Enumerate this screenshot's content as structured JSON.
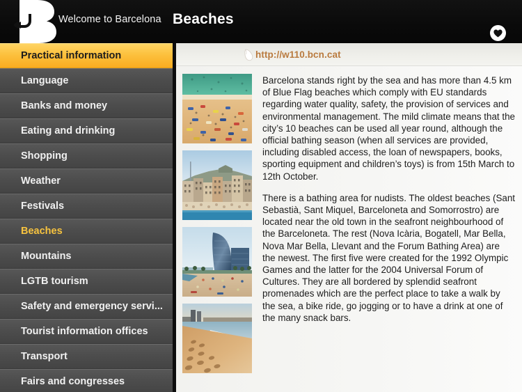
{
  "header": {
    "logo_icon": "barcelona-b-back-arrow-logo",
    "back_label": "Welcome to Barcelona",
    "title": "Beaches",
    "favorite_icon": "heart-icon"
  },
  "sidebar": {
    "items": [
      {
        "label": "Practical information",
        "state": "active"
      },
      {
        "label": "Language",
        "state": "normal"
      },
      {
        "label": "Banks and money",
        "state": "normal"
      },
      {
        "label": "Eating and drinking",
        "state": "normal"
      },
      {
        "label": "Shopping",
        "state": "normal"
      },
      {
        "label": "Weather",
        "state": "normal"
      },
      {
        "label": "Festivals",
        "state": "normal"
      },
      {
        "label": "Beaches",
        "state": "current"
      },
      {
        "label": "Mountains",
        "state": "normal"
      },
      {
        "label": "LGTB tourism",
        "state": "normal"
      },
      {
        "label": "Safety and emergency servi...",
        "state": "normal"
      },
      {
        "label": "Tourist information offices",
        "state": "normal"
      },
      {
        "label": "Transport",
        "state": "normal"
      },
      {
        "label": "Fairs and congresses",
        "state": "normal"
      }
    ]
  },
  "content": {
    "url_icon": "mouse-pointer-icon",
    "url": "http://w110.bcn.cat",
    "thumbnails": [
      {
        "name": "aerial-beach-crowd-photo",
        "alt": "Aerial view of crowded sandy beach with turquoise sea"
      },
      {
        "name": "barceloneta-seafront-buildings-photo",
        "alt": "Seafront buildings with hill and crowded beach"
      },
      {
        "name": "w-hotel-beach-photo",
        "alt": "W Barcelona hotel sail tower beside the beach"
      },
      {
        "name": "footprints-sand-beach-photo",
        "alt": "Footprints in sand at sunset with waves"
      }
    ],
    "paragraphs": [
      "Barcelona stands right by the sea and has more than 4.5 km of Blue Flag beaches which comply with EU standards regarding water quality, safety, the provision of services and environmental management. The mild climate means that the city’s 10 beaches can be used all year round, although the official bathing season (when all services are provided, including disabled access, the loan of newspapers, books, sporting equipment and children’s toys) is from 15th March to 12th October.",
      "There is a bathing area for nudists. The oldest beaches (Sant Sebastià, Sant Miquel, Barceloneta and Somorrostro) are located near the old town in the seafront neighbourhood of the Barceloneta. The rest (Nova Icària, Bogatell, Mar Bella, Nova Mar Bella, Llevant and the Forum Bathing Area) are the newest. The first five were created for the 1992 Olympic Games and the latter for the 2004 Universal Forum of Cultures. They are all bordered by splendid seafront promenades which are the perfect place to take a walk by the sea, a bike ride, go jogging or to have a drink at one of the many snack bars."
    ]
  },
  "colors": {
    "accent_yellow": "#fcc13e",
    "current_text": "#f7c33f",
    "url_brown": "#b97a3e",
    "sidebar_gray": "#4d4d4d",
    "header_black": "#0d0d0d"
  }
}
